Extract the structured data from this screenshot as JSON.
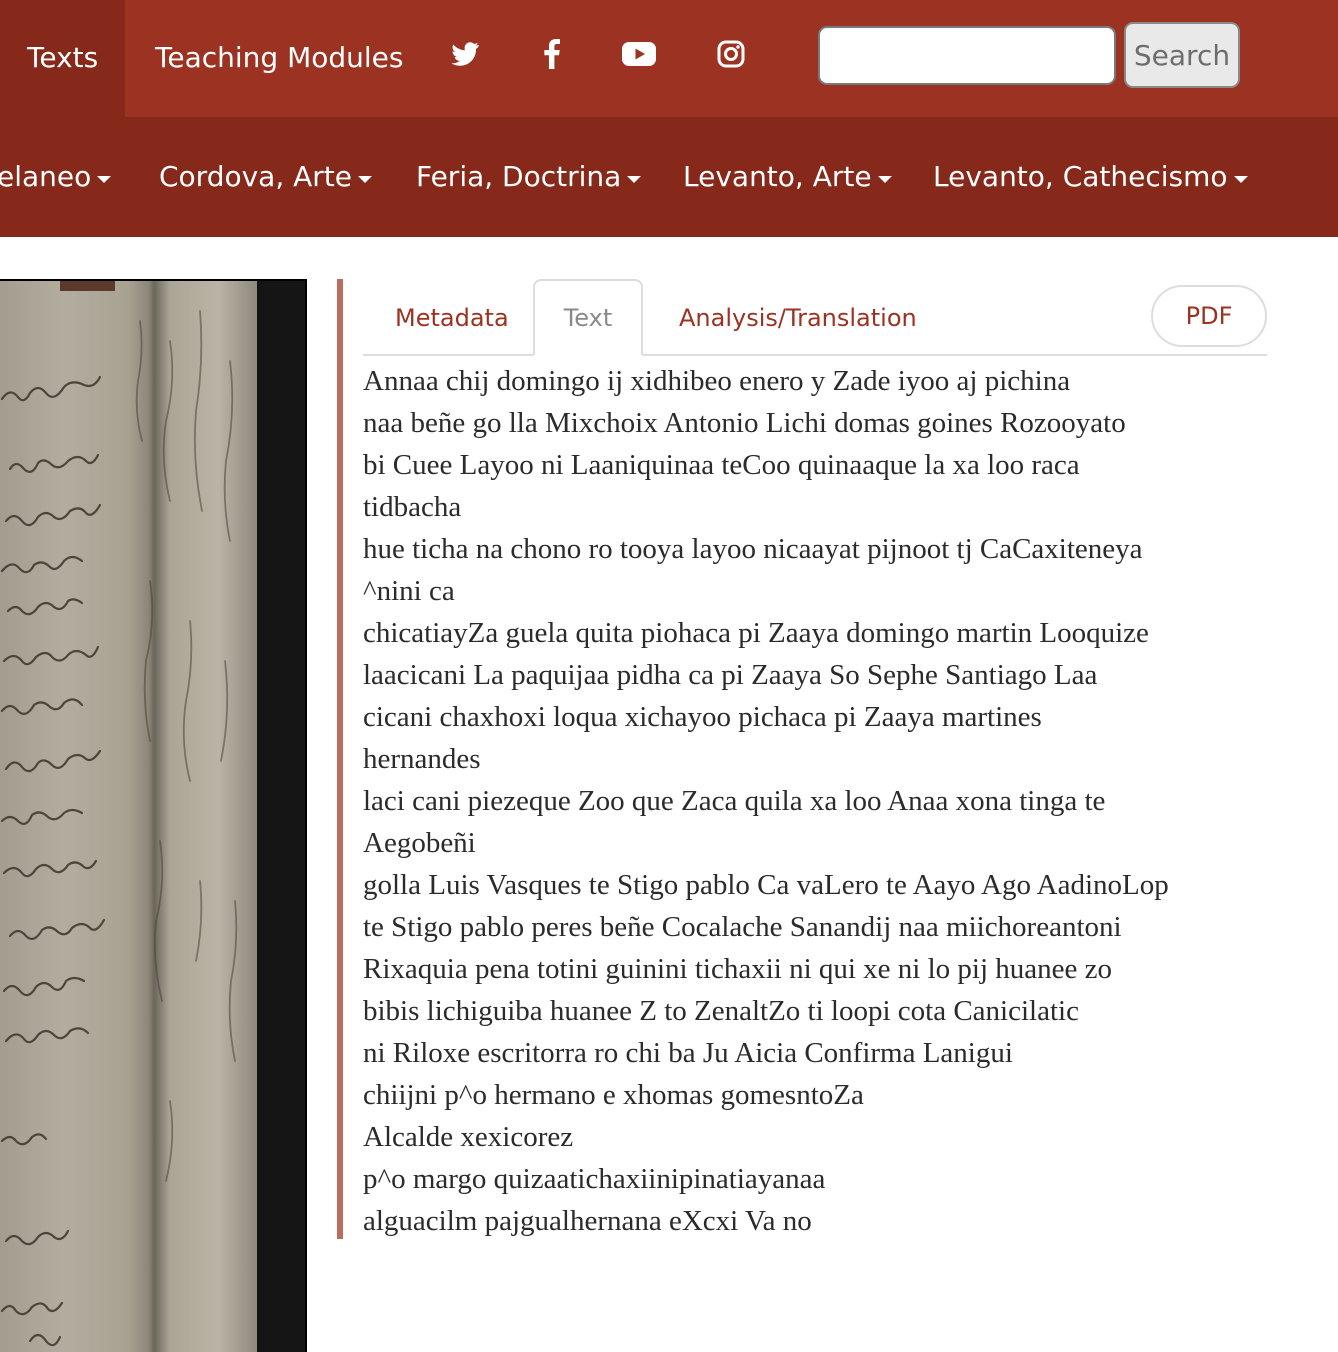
{
  "top_nav": {
    "texts_label": "Texts",
    "teaching_modules_label": "Teaching Modules",
    "social": [
      "twitter-icon",
      "facebook-icon",
      "youtube-icon",
      "instagram-icon"
    ],
    "search_placeholder": "",
    "search_button_label": "Search"
  },
  "sub_nav": [
    {
      "label": "elaneo"
    },
    {
      "label": "Cordova, Arte"
    },
    {
      "label": "Feria, Doctrina"
    },
    {
      "label": "Levanto, Arte"
    },
    {
      "label": "Levanto, Cathecismo"
    }
  ],
  "tabs": {
    "metadata": "Metadata",
    "text": "Text",
    "analysis": "Analysis/Translation",
    "pdf": "PDF"
  },
  "transcript_lines": [
    "Annaa chij domingo ij xidhibeo enero y Zade iyoo aj pichina",
    "naa beñe go lla Mixchoix Antonio Lichi domas goines Rozooyato",
    "bi Cuee Layoo ni Laaniquinaa teCoo quinaaque la xa loo raca",
    "tidbacha",
    "hue ticha na chono ro tooya layoo nicaayat pijnoot tj CaCaxiteneya",
    "^nini ca",
    "chicatiayZa guela quita piohaca pi Zaaya domingo martin Looquize",
    "laacicani La paquijaa pidha ca pi Zaaya So Sephe Santiago Laa",
    "cicani chaxhoxi loqua xichayoo pichaca pi Zaaya martines",
    "hernandes",
    "laci cani piezeque Zoo que Zaca quila xa loo Anaa xona tinga te",
    "Aegobeñi",
    "golla Luis Vasques te Stigo pablo Ca vaLero te Aayo Ago AadinoLop",
    "te Stigo pablo peres beñe Cocalache Sanandij naa miichoreantoni",
    "Rixaquia pena totini guinini tichaxii ni qui xe ni lo pij huanee zo",
    "bibis lichiguiba huanee Z to ZenaltZo ti loopi cota Canicilatic",
    "ni Riloxe escritorra ro chi ba Ju Aicia Confirma Lanigui",
    "chiijni p^o hermano e xhomas gomesntoZa",
    "Alcalde xexicorez",
    "p^o margo quizaatichaxiinipinatiayanaa",
    "alguacilm pajgualhernana eXcxi Va no"
  ],
  "colors": {
    "top_nav_bg": "#9c3222",
    "sub_nav_bg": "#86291b",
    "accent_border": "#b86e61",
    "link": "#9c3222"
  }
}
